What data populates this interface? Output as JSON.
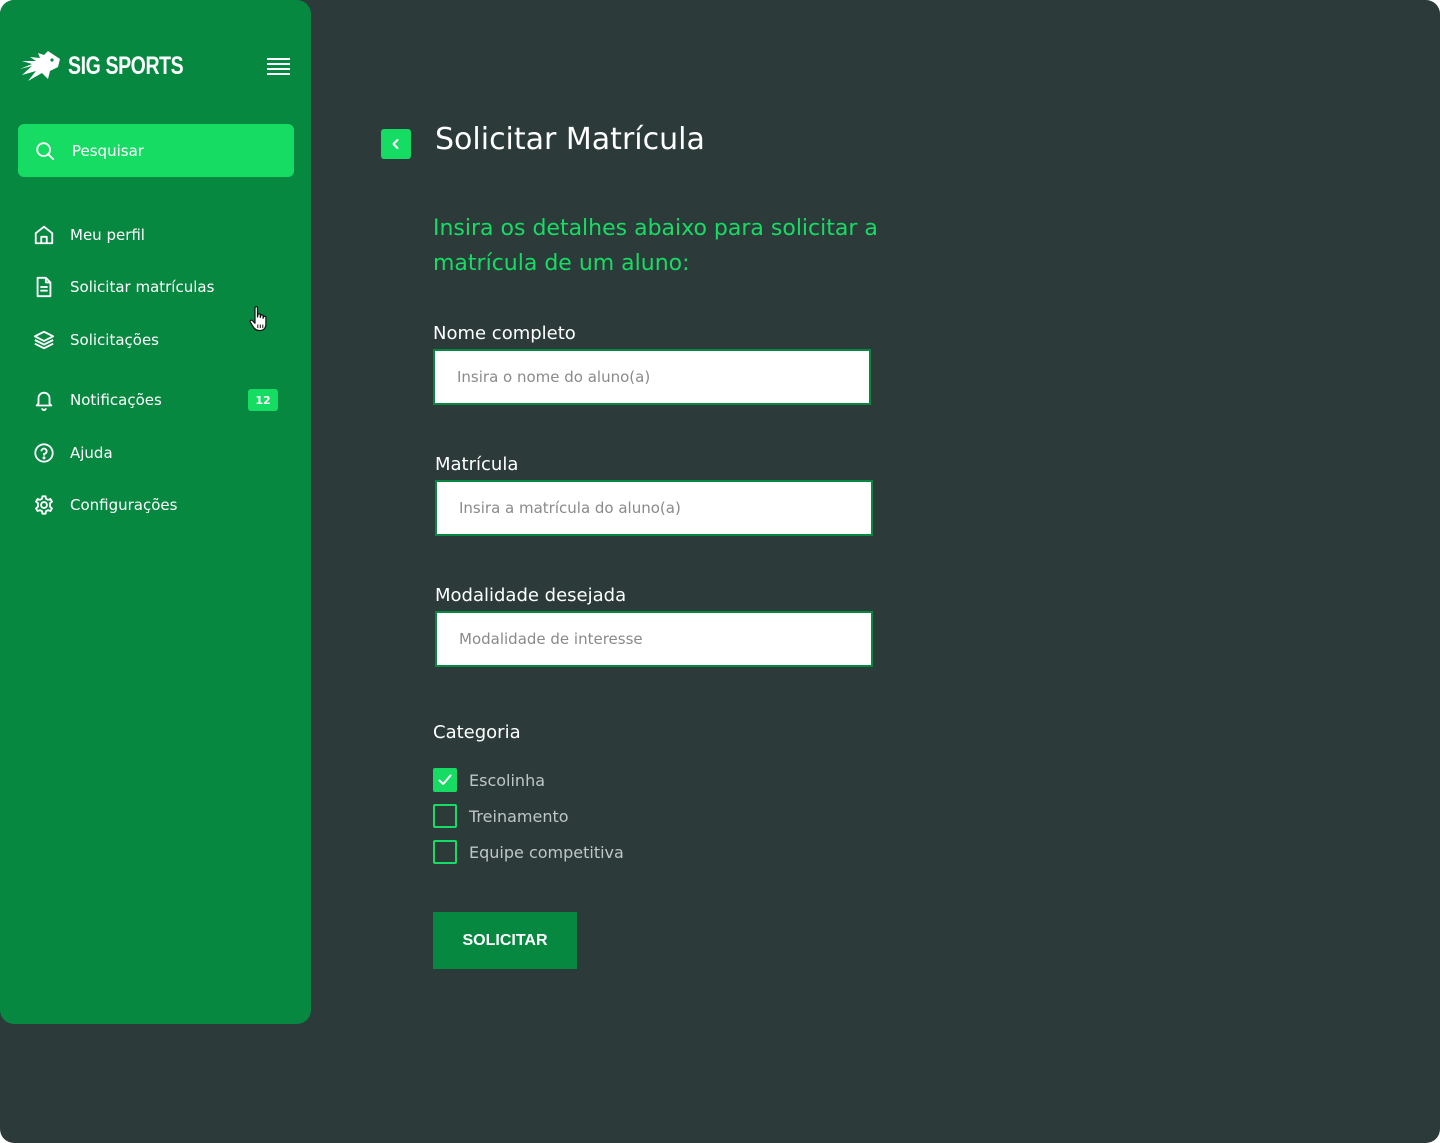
{
  "brand": {
    "name": "SIG SPORTS"
  },
  "sidebar": {
    "search_label": "Pesquisar",
    "items": [
      {
        "label": "Meu perfil",
        "icon": "home-icon"
      },
      {
        "label": "Solicitar matrículas",
        "icon": "document-icon"
      },
      {
        "label": "Solicitações",
        "icon": "layers-icon"
      },
      {
        "label": "Notificações",
        "icon": "bell-icon",
        "badge": "12"
      },
      {
        "label": "Ajuda",
        "icon": "help-circle-icon"
      },
      {
        "label": "Configurações",
        "icon": "gear-icon"
      }
    ]
  },
  "main": {
    "title": "Solicitar Matrícula",
    "subtitle": "Insira os detalhes abaixo para solicitar a matrícula de um aluno:",
    "fields": [
      {
        "label": "Nome completo",
        "placeholder": "Insira o nome do aluno(a)",
        "value": ""
      },
      {
        "label": "Matrícula",
        "placeholder": "Insira a matrícula do aluno(a)",
        "value": ""
      },
      {
        "label": "Modalidade desejada",
        "placeholder": "Modalidade de interesse",
        "value": ""
      }
    ],
    "category": {
      "label": "Categoria",
      "options": [
        {
          "label": "Escolinha",
          "checked": true
        },
        {
          "label": "Treinamento",
          "checked": false
        },
        {
          "label": "Equipe competitiva",
          "checked": false
        }
      ]
    },
    "submit_label": "SOLICITAR"
  },
  "colors": {
    "background": "#2c3a3a",
    "sidebar": "#068840",
    "accent": "#17dc64",
    "text": "#ffffff"
  }
}
